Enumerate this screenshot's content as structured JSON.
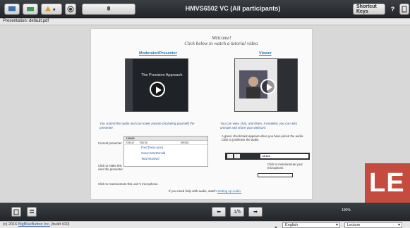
{
  "topbar": {
    "title": "HMVS6502 VC (All participants)",
    "shortcut_keys": "Shortcut Keys",
    "help": "?"
  },
  "presentation": {
    "header": "Presentation: default.pdf"
  },
  "slide": {
    "welcome_line1": "Welcome!",
    "welcome_line2": "Click below to watch a tutorial video.",
    "moderator_link": "Moderator/Presenter",
    "viewer_link": "Viewer",
    "video_title": "The Precision Approach",
    "moderator_desc": "You control the audio and can make anyone (including yourself) the presenter.",
    "viewer_desc": "You can view, chat, and listen. If enabled, you can also unmute and share your webcam.",
    "users_panel": {
      "title": "Users",
      "headers": [
        "Status",
        "Name",
        "Media"
      ],
      "rows": [
        "Fred Dixon (you)",
        "Susan MacDonald",
        "Tara McDavid"
      ]
    },
    "current_presenter": "Current presenter",
    "click_make_presenter": "Click to make this user the presenter.",
    "click_mute_user": "Click to mute/unmute this user's microphone.",
    "green_check": "A green checkmark appears when you have joined the audio. Click to join/leave the audio.",
    "click_mute_mic": "Click to mute/unmute your microphone.",
    "muted_label": "Muted",
    "need_help": "If you need help with audio, watch",
    "setting_up_audio": "Setting up Audio."
  },
  "nav": {
    "page": "1/5",
    "zoom": "100%"
  },
  "footer": {
    "copyright_prefix": "(c) 2016 ",
    "copyright_link": "BigBlueButton Inc.",
    "copyright_suffix": " (build 410)",
    "language": "English",
    "layout": "Lecture"
  },
  "overlay_logo": "LE"
}
